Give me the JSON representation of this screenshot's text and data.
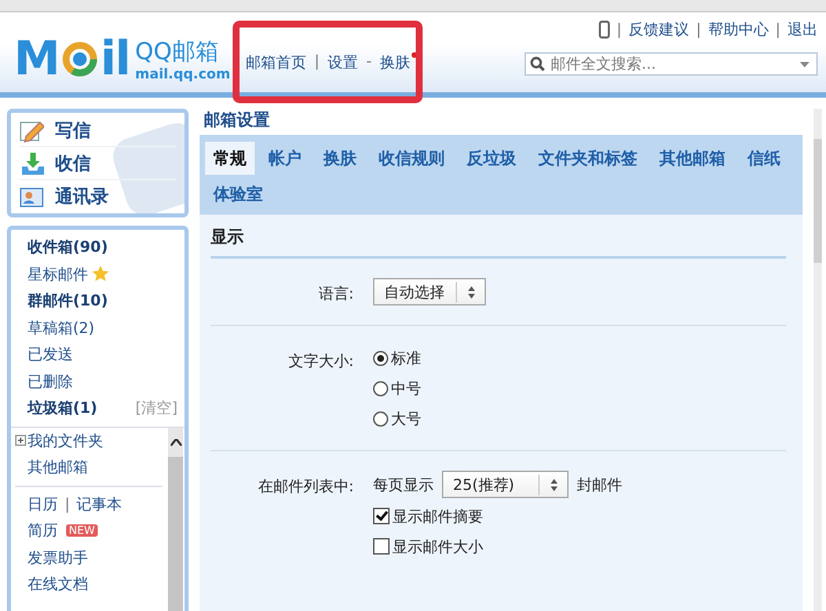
{
  "header": {
    "logo_mark": [
      "M",
      "il"
    ],
    "logo_text": "QQ邮箱",
    "logo_url": "mail.qq.com",
    "nav": [
      {
        "kind": "link",
        "label": "邮箱首页"
      },
      {
        "kind": "sep",
        "label": "|"
      },
      {
        "kind": "link",
        "label": "设置"
      },
      {
        "kind": "sep",
        "label": "-"
      },
      {
        "kind": "link",
        "label": "换肤",
        "dot": true
      }
    ],
    "top_links": [
      {
        "kind": "phone"
      },
      {
        "kind": "sep",
        "label": "|"
      },
      {
        "kind": "link",
        "label": "反馈建议"
      },
      {
        "kind": "sep",
        "label": "|"
      },
      {
        "kind": "link",
        "label": "帮助中心"
      },
      {
        "kind": "sep",
        "label": "|"
      },
      {
        "kind": "link",
        "label": "退出"
      }
    ],
    "search": {
      "placeholder": "邮件全文搜索..."
    },
    "annotation_frame": true
  },
  "sidebar": {
    "actions": [
      {
        "kind": "compose",
        "label": "写信"
      },
      {
        "kind": "receive",
        "label": "收信"
      },
      {
        "kind": "contacts",
        "label": "通讯录"
      }
    ],
    "folders": [
      {
        "label": "收件箱(90)",
        "unread": true
      },
      {
        "label": "星标邮件",
        "unread": false,
        "star": true
      },
      {
        "label": "群邮件(10)",
        "unread": true
      },
      {
        "label": "草稿箱(2)",
        "unread": false
      },
      {
        "label": "已发送",
        "unread": false
      },
      {
        "label": "已删除",
        "unread": false
      },
      {
        "label": "垃圾箱(1)",
        "unread": true,
        "action": "[清空]"
      }
    ],
    "more": [
      {
        "kind": "expander",
        "label": "我的文件夹",
        "expanded": false
      },
      {
        "kind": "item",
        "label": "其他邮箱"
      }
    ],
    "tools": [
      {
        "parts": [
          "日历",
          "|",
          "记事本"
        ]
      },
      {
        "parts": [
          "简历"
        ],
        "badge": "NEW"
      },
      {
        "parts": [
          "发票助手"
        ]
      },
      {
        "parts": [
          "在线文档"
        ]
      }
    ]
  },
  "main": {
    "title": "邮箱设置",
    "tabs": [
      {
        "label": "常规",
        "selected": true
      },
      {
        "label": "帐户",
        "selected": false
      },
      {
        "label": "换肤",
        "selected": false
      },
      {
        "label": "收信规则",
        "selected": false
      },
      {
        "label": "反垃圾",
        "selected": false
      },
      {
        "label": "文件夹和标签",
        "selected": false
      },
      {
        "label": "其他邮箱",
        "selected": false
      },
      {
        "label": "信纸",
        "selected": false
      },
      {
        "label": "体验室",
        "selected": false
      }
    ],
    "section": "显示",
    "rows": [
      {
        "label": "语言:",
        "controls": [
          {
            "kind": "select",
            "value": "自动选择"
          }
        ]
      },
      {
        "label": "文字大小:",
        "controls": [
          {
            "kind": "radio",
            "label": "标准",
            "selected": true
          },
          {
            "kind": "radio",
            "label": "中号",
            "selected": false
          },
          {
            "kind": "radio",
            "label": "大号",
            "selected": false
          }
        ]
      },
      {
        "label": "在邮件列表中:",
        "controls": [
          {
            "kind": "inline",
            "before": "每页显示",
            "value": "25(推荐)",
            "after": "封邮件"
          },
          {
            "kind": "checkbox",
            "label": "显示邮件摘要",
            "checked": true
          },
          {
            "kind": "checkbox",
            "label": "显示邮件大小",
            "checked": false
          }
        ]
      }
    ]
  }
}
